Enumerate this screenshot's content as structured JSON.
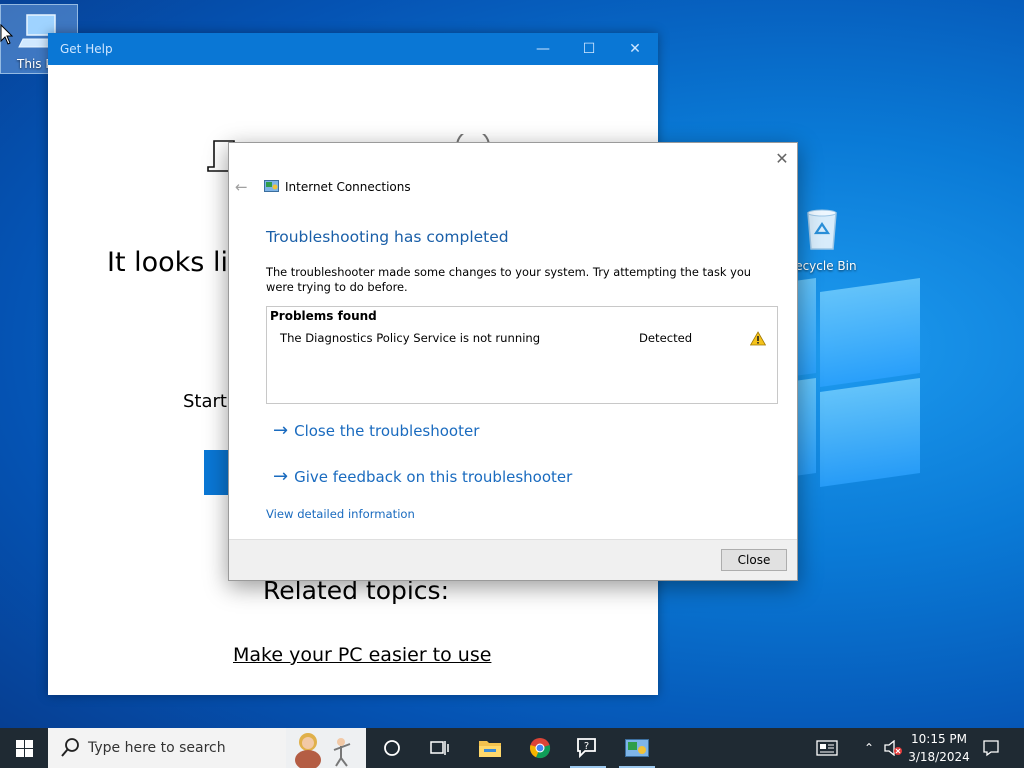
{
  "desktop": {
    "icons": [
      {
        "label": "This PC"
      },
      {
        "label": "Recycle Bin"
      }
    ]
  },
  "get_help": {
    "title": "Get Help",
    "headline": "It looks lik",
    "start_text": "Start",
    "related_title": "Related topics:",
    "related_link": "Make your PC easier to use"
  },
  "dialog": {
    "app_name": "Internet Connections",
    "heading": "Troubleshooting has completed",
    "description": "The troubleshooter made some changes to your system. Try attempting the task you were trying to do before.",
    "problems": {
      "header": "Problems found",
      "rows": [
        {
          "name": "The Diagnostics Policy Service is not running",
          "status": "Detected",
          "icon": "warning-icon"
        }
      ]
    },
    "links": {
      "close_troubleshooter": "Close the troubleshooter",
      "give_feedback": "Give feedback on this troubleshooter",
      "view_details": "View detailed information"
    },
    "close_button": "Close"
  },
  "taskbar": {
    "search_placeholder": "Type here to search",
    "pinned": [
      "cortana-icon",
      "task-view-icon",
      "file-explorer-icon",
      "chrome-icon",
      "get-help-icon",
      "troubleshooter-icon"
    ],
    "clock": {
      "time": "10:15 PM",
      "date": "3/18/2024"
    }
  },
  "colors": {
    "taskbar": "#1f2a33",
    "titlebar": "#0a77d5",
    "link": "#1a6bbf",
    "heading": "#1a5fa8"
  }
}
